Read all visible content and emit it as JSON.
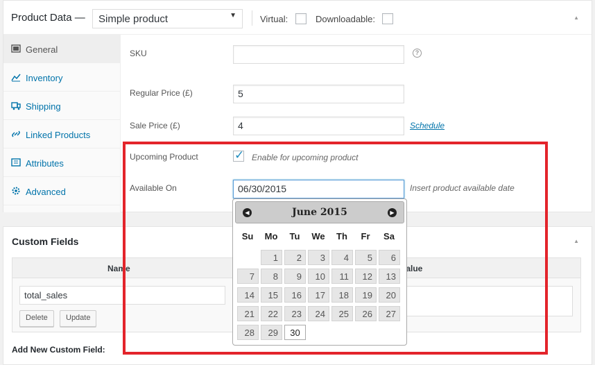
{
  "product_data": {
    "title": "Product Data —",
    "type_select": "Simple product",
    "virtual_label": "Virtual:",
    "downloadable_label": "Downloadable:",
    "tabs": [
      {
        "label": "General",
        "icon": "general-icon"
      },
      {
        "label": "Inventory",
        "icon": "inventory-icon"
      },
      {
        "label": "Shipping",
        "icon": "shipping-icon"
      },
      {
        "label": "Linked Products",
        "icon": "link-icon"
      },
      {
        "label": "Attributes",
        "icon": "attributes-icon"
      },
      {
        "label": "Advanced",
        "icon": "gear-icon"
      }
    ],
    "fields": {
      "sku_label": "SKU",
      "sku_value": "",
      "regular_price_label": "Regular Price (£)",
      "regular_price_value": "5",
      "sale_price_label": "Sale Price (£)",
      "sale_price_value": "4",
      "schedule_link": "Schedule",
      "upcoming_label": "Upcoming Product",
      "upcoming_checkbox_text": "Enable for upcoming product",
      "upcoming_checked": true,
      "available_label": "Available On",
      "available_value": "06/30/2015",
      "available_desc": "Insert product available date"
    }
  },
  "datepicker": {
    "month_title": "June 2015",
    "weekdays": [
      "Su",
      "Mo",
      "Tu",
      "We",
      "Th",
      "Fr",
      "Sa"
    ],
    "first_weekday_index": 1,
    "days": [
      "1",
      "2",
      "3",
      "4",
      "5",
      "6",
      "7",
      "8",
      "9",
      "10",
      "11",
      "12",
      "13",
      "14",
      "15",
      "16",
      "17",
      "18",
      "19",
      "20",
      "21",
      "22",
      "23",
      "24",
      "25",
      "26",
      "27",
      "28",
      "29",
      "30"
    ],
    "selected_day": "30"
  },
  "custom_fields": {
    "title": "Custom Fields",
    "col_name": "Name",
    "col_value": "Value",
    "row_name": "total_sales",
    "delete_label": "Delete",
    "update_label": "Update",
    "add_new_label": "Add New Custom Field:"
  },
  "colors": {
    "link": "#0073aa",
    "highlight": "#e3242b"
  }
}
